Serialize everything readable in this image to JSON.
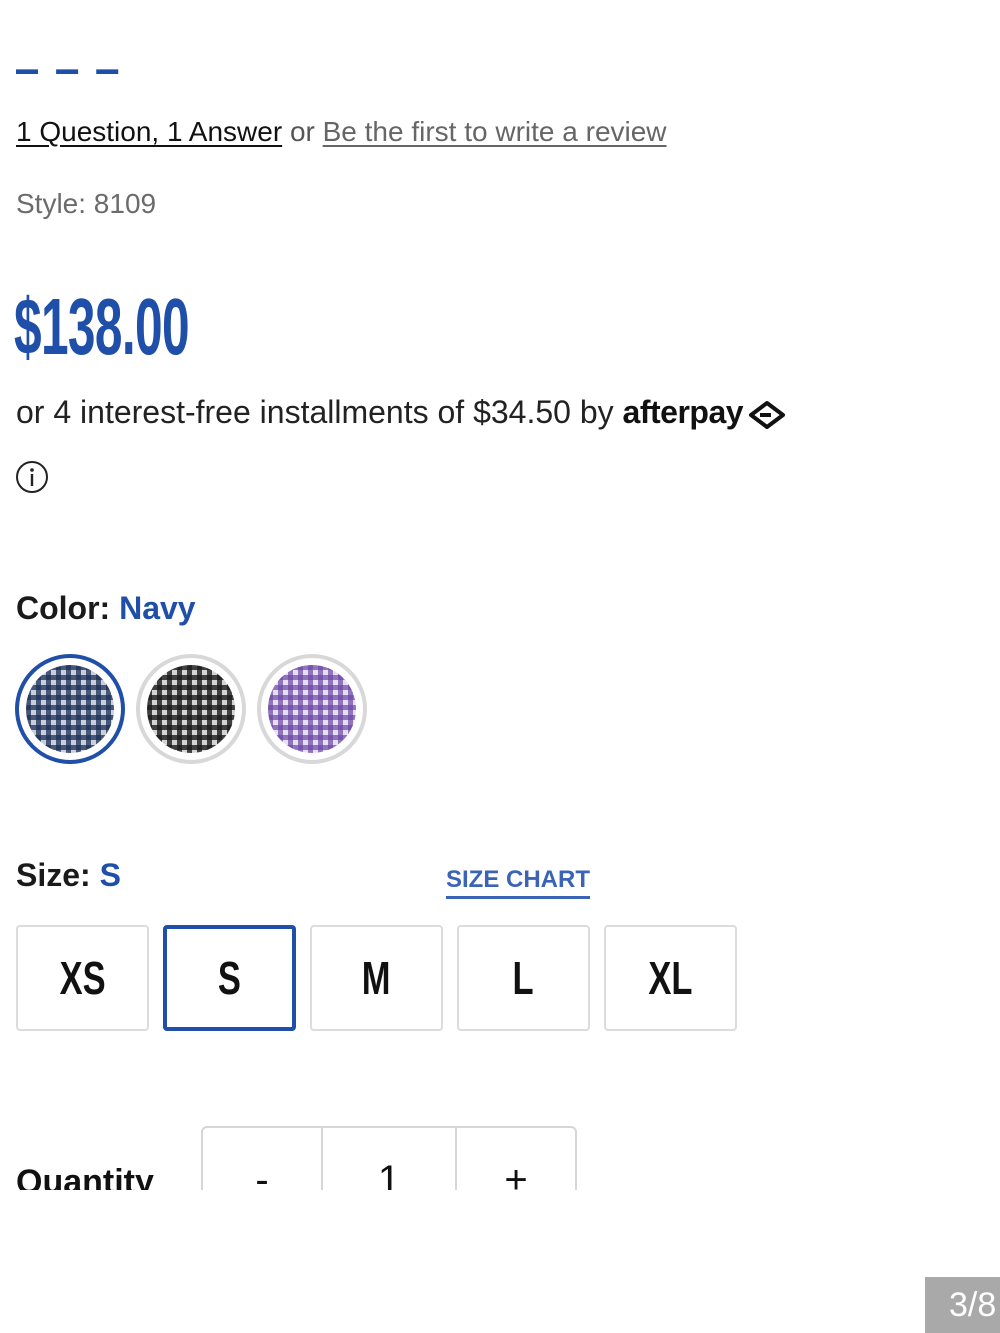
{
  "reviews": {
    "qa_link": "1 Question, 1 Answer",
    "separator": "or",
    "review_link": "Be the first to write a review"
  },
  "style_line": "Style: 8109",
  "price": "$138.00",
  "afterpay": {
    "text": "or 4 interest-free installments of $34.50 by",
    "brand": "afterpay"
  },
  "color": {
    "label": "Color:",
    "value": "Navy",
    "swatches": [
      {
        "name": "navy gingham",
        "colors": [
          "#1c2e55",
          "#c9cfdc"
        ],
        "selected": true
      },
      {
        "name": "black gingham",
        "colors": [
          "#1b1b1b",
          "#d4d4d4"
        ],
        "selected": false
      },
      {
        "name": "purple gingham",
        "colors": [
          "#6b47a6",
          "#dcd2ee"
        ],
        "selected": false
      }
    ]
  },
  "size": {
    "label": "Size:",
    "value": "S",
    "chart_link": "SIZE CHART",
    "options": [
      "XS",
      "S",
      "M",
      "L",
      "XL"
    ],
    "selected": "S"
  },
  "quantity": {
    "label": "Quantity",
    "minus": "-",
    "value": "1",
    "plus": "+"
  },
  "page_counter": "3/8",
  "colors": {
    "accent": "#1f4fa8",
    "border": "#dcdcdc"
  }
}
